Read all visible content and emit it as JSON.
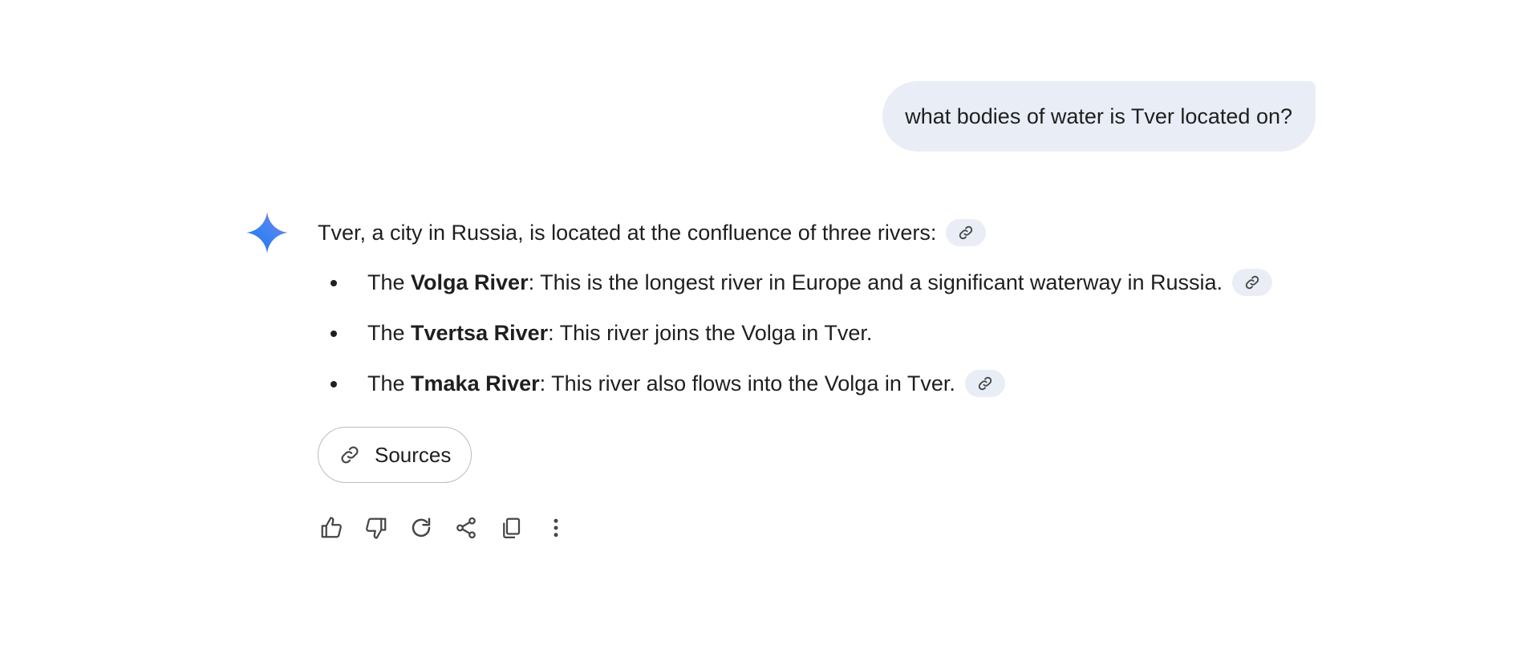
{
  "conversation": {
    "user_message": "what bodies of water is Tver located on?",
    "response": {
      "intro": "Tver, a city in Russia, is located at the confluence of three rivers:",
      "bullets": [
        {
          "prefix": "The ",
          "bold": "Volga River",
          "rest": ": This is the longest river in Europe and a significant waterway in Russia.",
          "has_citation": true
        },
        {
          "prefix": "The ",
          "bold": "Tvertsa River",
          "rest": ": This river joins the Volga in Tver.",
          "has_citation": false
        },
        {
          "prefix": "The ",
          "bold": "Tmaka River",
          "rest": ": This river also flows into the Volga in Tver.",
          "has_citation": true
        }
      ],
      "sources_label": "Sources"
    }
  },
  "actions": [
    {
      "name": "thumbs-up-icon"
    },
    {
      "name": "thumbs-down-icon"
    },
    {
      "name": "regenerate-icon"
    },
    {
      "name": "share-icon"
    },
    {
      "name": "copy-icon"
    },
    {
      "name": "more-vert-icon"
    }
  ],
  "colors": {
    "bubble_bg": "#e9eef6",
    "text": "#1f1f1f",
    "icon": "#444746",
    "gem_start": "#4285f4",
    "gem_end": "#9b72cb"
  }
}
